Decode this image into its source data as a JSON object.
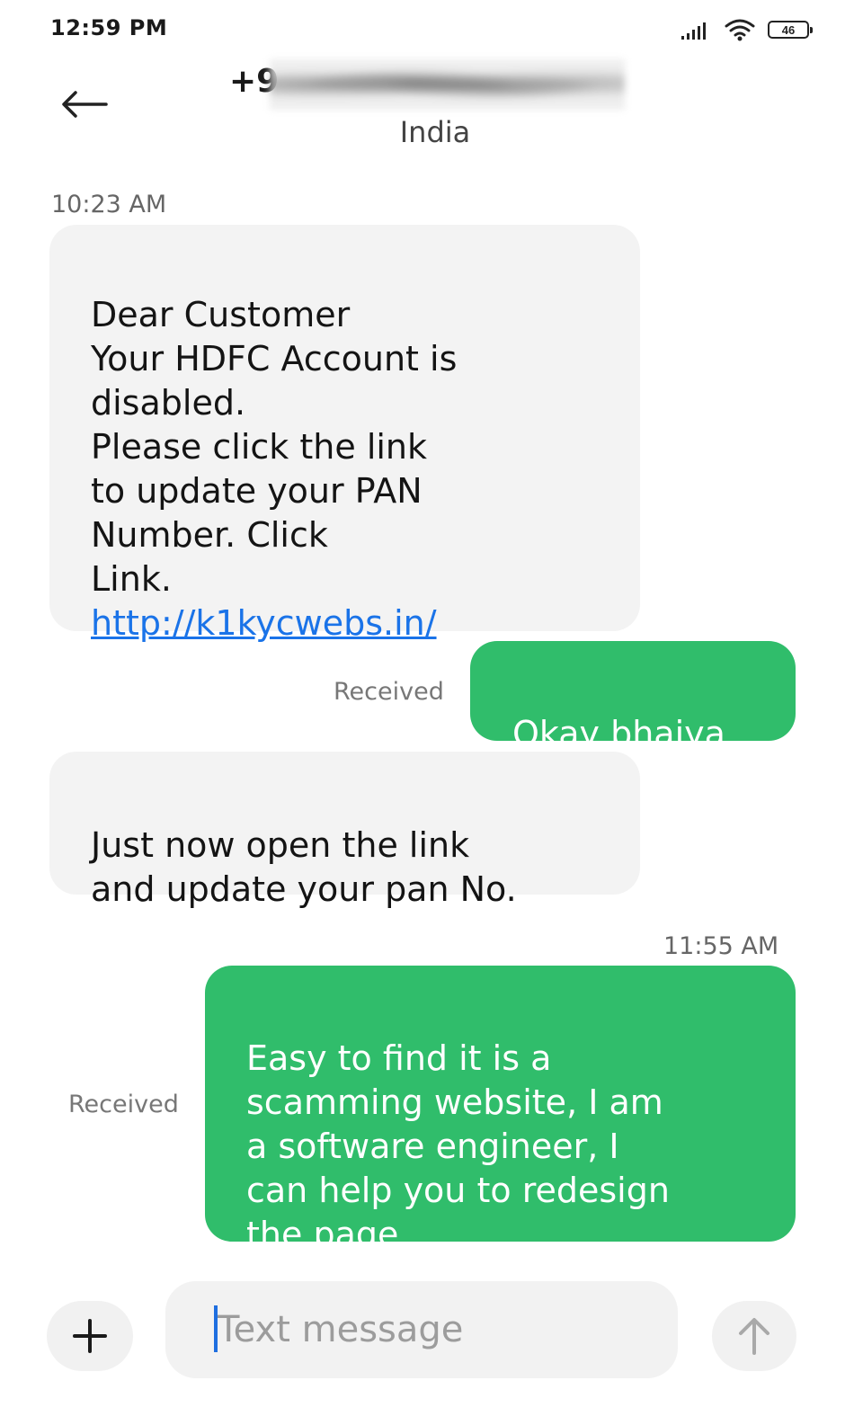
{
  "status_bar": {
    "time": "12:59 PM",
    "battery": "46",
    "icons": [
      "signal-icon",
      "wifi-icon",
      "battery-icon"
    ]
  },
  "header": {
    "number_visible": "+9",
    "location": "India"
  },
  "conversation": {
    "first_timestamp": "10:23 AM",
    "msg1_text": "Dear Customer\nYour HDFC Account is\ndisabled.\nPlease click the link\nto update your PAN\nNumber. Click\nLink.",
    "msg1_link": "http://k1kycwebs.in/",
    "msg2_text": "Okay bhaiya",
    "msg2_status": "Received",
    "msg3_text": "Just now open the link\nand update your pan No.",
    "second_timestamp": "11:55 AM",
    "msg4_text": "Easy to find it is a\nscamming website, I am\na software engineer, I\ncan help you to redesign\nthe page",
    "msg4_status": "Received"
  },
  "composer": {
    "placeholder": "Text message",
    "icons": [
      "plus-icon",
      "arrow-up-icon"
    ]
  },
  "colors": {
    "outgoing_bubble": "#30bd6b",
    "incoming_bubble": "#f3f3f3",
    "link": "#1a73e8",
    "caret": "#1f6fe0"
  }
}
